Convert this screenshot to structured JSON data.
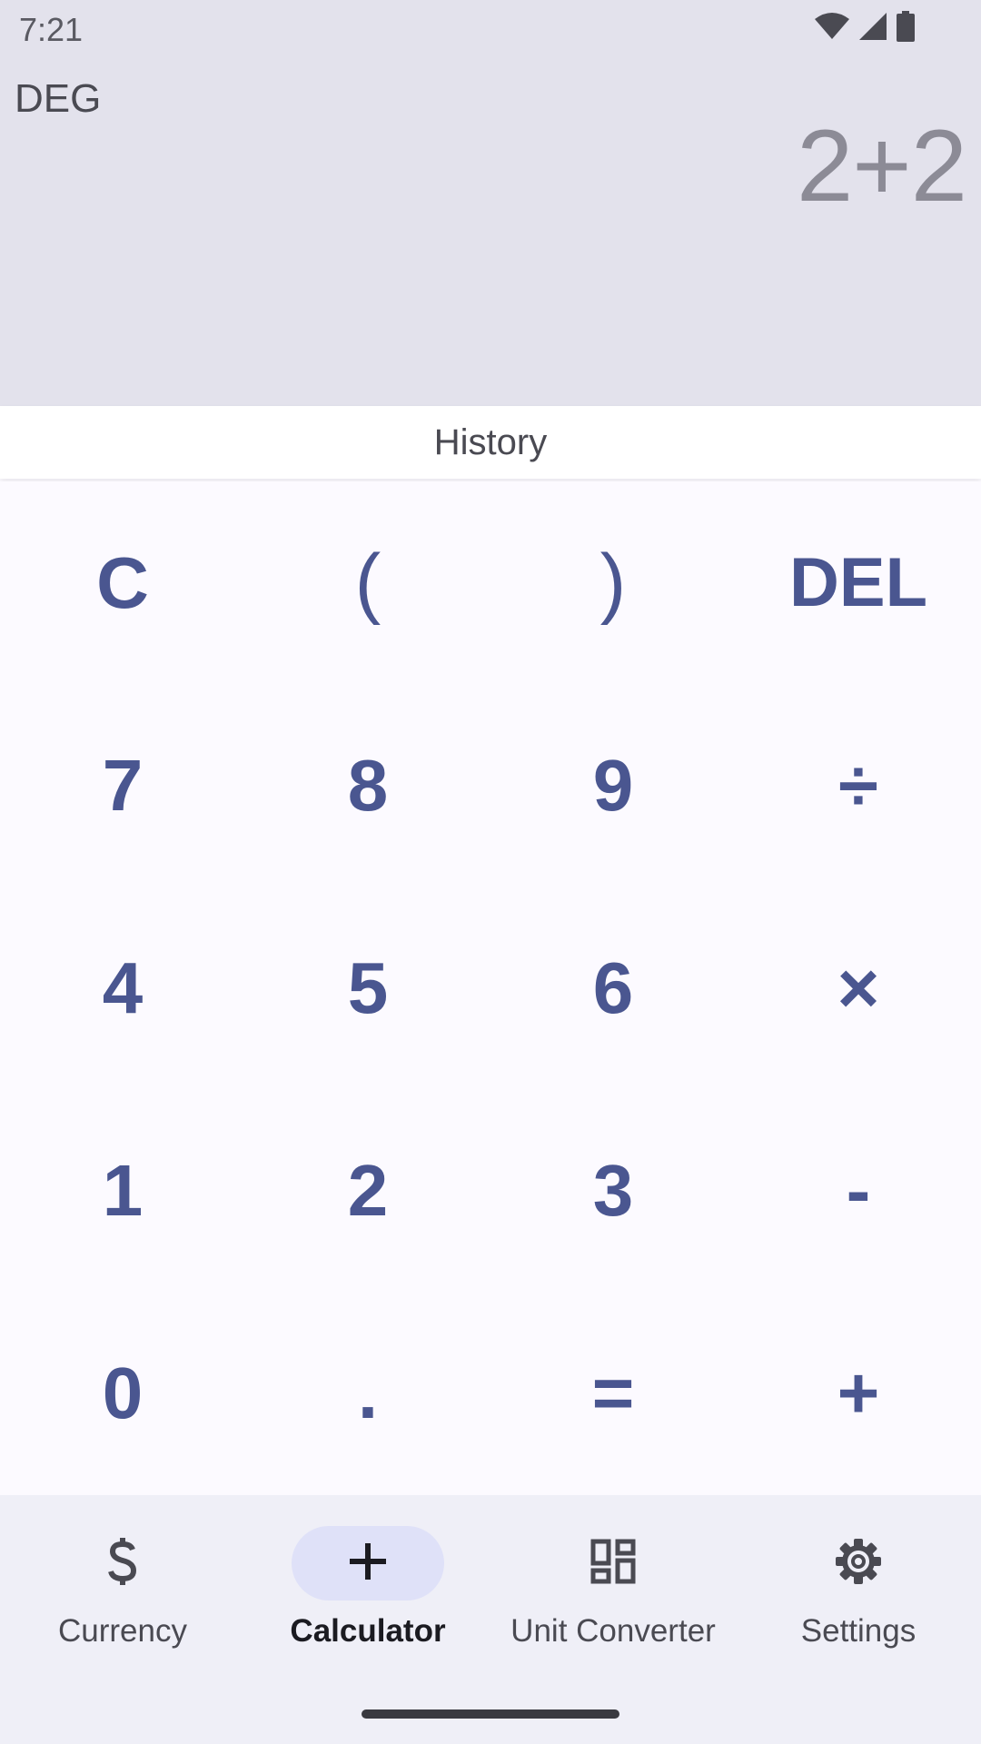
{
  "status_bar": {
    "time": "7:21",
    "icons": [
      "wifi-icon",
      "cell-signal-icon",
      "battery-icon"
    ]
  },
  "display": {
    "angle_mode": "DEG",
    "expression": "2+2"
  },
  "history": {
    "label": "History"
  },
  "keypad": {
    "rows": [
      [
        "C",
        "(",
        ")",
        "DEL"
      ],
      [
        "7",
        "8",
        "9",
        "÷"
      ],
      [
        "4",
        "5",
        "6",
        "×"
      ],
      [
        "1",
        "2",
        "3",
        "-"
      ],
      [
        "0",
        ".",
        "=",
        "+"
      ]
    ]
  },
  "nav": {
    "items": [
      {
        "label": "Currency",
        "icon": "dollar-icon",
        "active": false
      },
      {
        "label": "Calculator",
        "icon": "plus-icon",
        "active": true
      },
      {
        "label": "Unit Converter",
        "icon": "dashboard-icon",
        "active": false
      },
      {
        "label": "Settings",
        "icon": "gear-icon",
        "active": false
      }
    ]
  },
  "colors": {
    "display_bg": "#e3e2ec",
    "key_text": "#4a5690",
    "nav_bg": "#efeff7",
    "nav_active_pill": "#dfe1f8"
  }
}
